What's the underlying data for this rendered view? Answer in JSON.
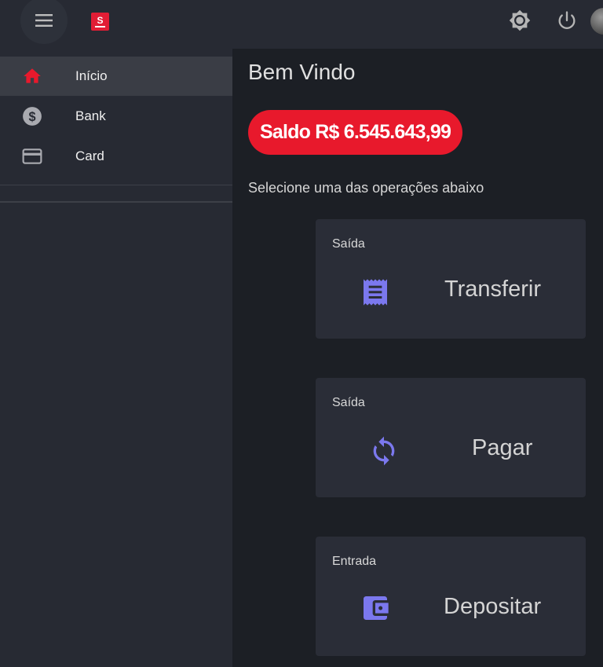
{
  "header": {
    "menu_icon": "hamburger-menu-icon",
    "logo_text": "S",
    "theme_icon": "brightness-icon",
    "power_icon": "power-icon",
    "avatar": "user-avatar"
  },
  "sidebar": {
    "items": [
      {
        "label": "Início",
        "icon": "home-icon",
        "active": true
      },
      {
        "label": "Bank",
        "icon": "dollar-circle-icon",
        "active": false
      },
      {
        "label": "Card",
        "icon": "credit-card-icon",
        "active": false
      }
    ]
  },
  "main": {
    "title": "Bem Vindo",
    "balance": "Saldo R$ 6.545.643,99",
    "instruction": "Selecione uma das operações abaixo",
    "operations": [
      {
        "type": "Saída",
        "action": "Transferir",
        "icon": "receipt-icon"
      },
      {
        "type": "Saída",
        "action": "Pagar",
        "icon": "sync-icon"
      },
      {
        "type": "Entrada",
        "action": "Depositar",
        "icon": "wallet-icon"
      }
    ]
  },
  "colors": {
    "brand_red": "#e8192c",
    "accent_purple": "#7b78ee",
    "background": "#1c1f25",
    "surface": "#272a33"
  }
}
